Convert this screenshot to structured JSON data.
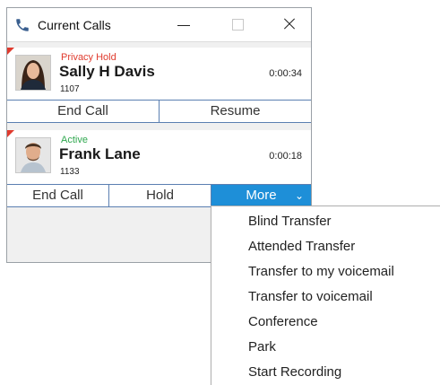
{
  "window": {
    "title": "Current Calls"
  },
  "calls": [
    {
      "status": "Privacy Hold",
      "status_color": "#e03b2e",
      "name": "Sally H Davis",
      "extension": "1107",
      "duration": "0:00:34",
      "buttons": {
        "end": "End Call",
        "resume": "Resume"
      }
    },
    {
      "status": "Active",
      "status_color": "#2fa84f",
      "name": "Frank Lane",
      "extension": "1133",
      "duration": "0:00:18",
      "buttons": {
        "end": "End Call",
        "hold": "Hold",
        "more": "More"
      }
    }
  ],
  "more_menu": {
    "items": [
      "Blind Transfer",
      "Attended Transfer",
      "Transfer to my voicemail",
      "Transfer to voicemail",
      "Conference",
      "Park",
      "Start Recording"
    ]
  },
  "colors": {
    "accent": "#1e8fd8",
    "button_border": "#5b7fb1",
    "flag": "#e03b2e"
  }
}
